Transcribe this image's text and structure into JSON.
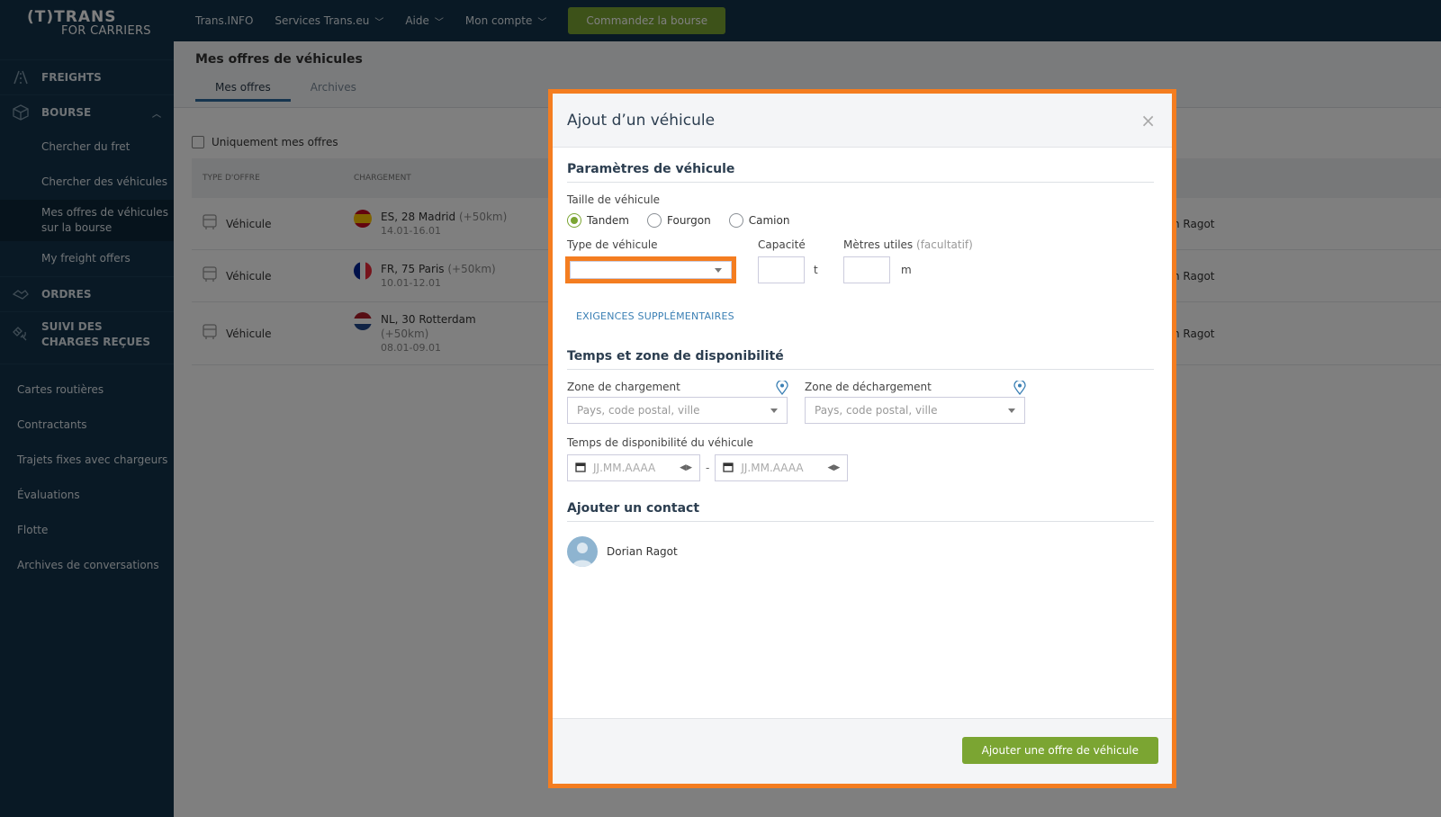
{
  "logo": {
    "line1": "(T)TRANS",
    "line2": "FOR CARRIERS"
  },
  "sidebar": {
    "freights": "FREIGHTS",
    "bourse": "BOURSE",
    "bourse_items": [
      "Chercher du fret",
      "Chercher des véhicules",
      "Mes offres de véhicules sur la bourse",
      "My freight offers"
    ],
    "ordres": "ORDRES",
    "suivi": "SUIVI DES CHARGES REÇUES",
    "secondary": [
      "Cartes routières",
      "Contractants",
      "Trajets fixes avec chargeurs",
      "Évaluations",
      "Flotte",
      "Archives de conversations"
    ]
  },
  "topbar": {
    "items": [
      "Trans.INFO",
      "Services Trans.eu",
      "Aide",
      "Mon compte"
    ],
    "cta": "Commandez la bourse"
  },
  "page": {
    "title": "Mes offres de véhicules",
    "tabs": [
      "Mes offres",
      "Archives"
    ],
    "filter_label": "Uniquement mes offres",
    "columns": [
      "TYPE D'OFFRE",
      "CHARGEMENT"
    ],
    "rows": [
      {
        "type": "Véhicule",
        "city": "ES, 28 Madrid",
        "radius": "(+50km)",
        "dates": "14.01-16.01",
        "person": "n Ragot"
      },
      {
        "type": "Véhicule",
        "city": "FR, 75 Paris",
        "radius": "(+50km)",
        "dates": "10.01-12.01",
        "person": "n Ragot"
      },
      {
        "type": "Véhicule",
        "city": "NL, 30 Rotterdam",
        "radius": "(+50km)",
        "dates": "08.01-09.01",
        "person": "n Ragot"
      }
    ]
  },
  "modal": {
    "title": "Ajout d’un véhicule",
    "close": "×",
    "sec_vehicle": "Paramètres de véhicule",
    "size_label": "Taille de véhicule",
    "sizes": [
      "Tandem",
      "Fourgon",
      "Camion"
    ],
    "type_label": "Type de véhicule",
    "capacity_label": "Capacité",
    "capacity_unit": "t",
    "meters_label": "Mètres utiles",
    "meters_optional": "(facultatif)",
    "meters_unit": "m",
    "extra_link": "EXIGENCES SUPPLÉMENTAIRES",
    "sec_time": "Temps et zone de disponibilité",
    "load_zone": "Zone de chargement",
    "unload_zone": "Zone de déchargement",
    "zone_placeholder": "Pays, code postal, ville",
    "time_label": "Temps de disponibilité du véhicule",
    "date_placeholder": "JJ.MM.AAAA",
    "date_sep": "-",
    "sec_contact": "Ajouter un contact",
    "contact_name": "Dorian Ragot",
    "submit": "Ajouter une offre de véhicule"
  }
}
